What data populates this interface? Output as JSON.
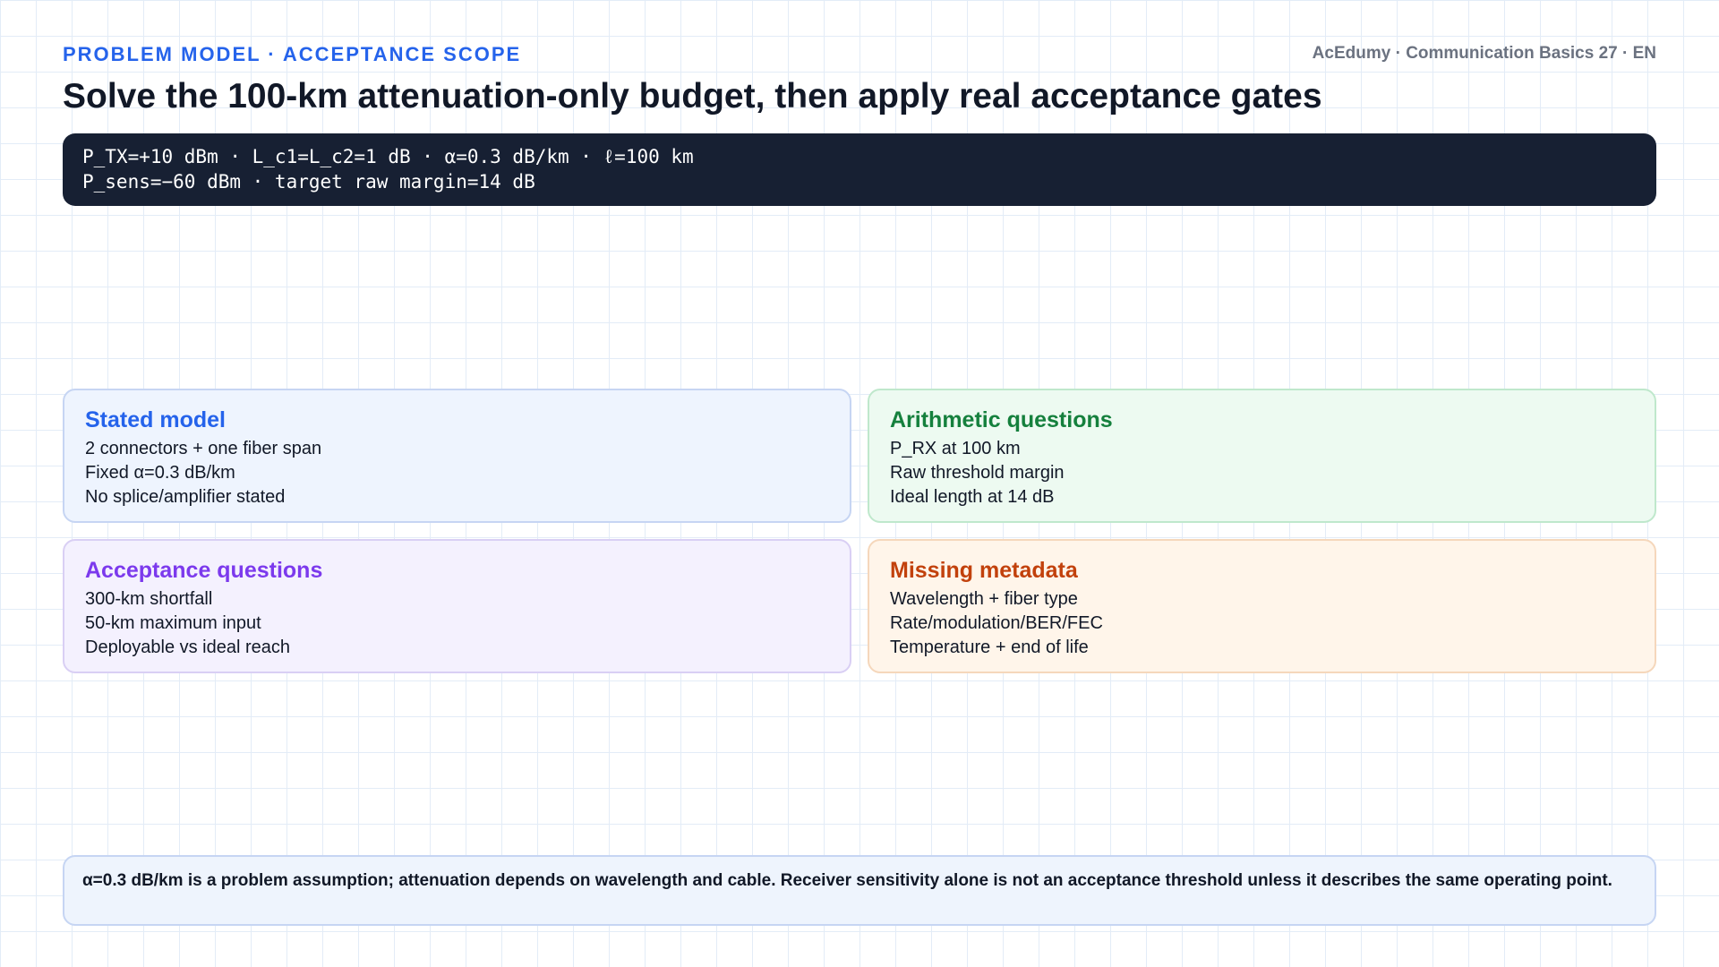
{
  "header": {
    "eyebrow": "PROBLEM MODEL · ACCEPTANCE SCOPE",
    "brand": "AcEdumy · Communication Basics 27 · EN",
    "title": "Solve the 100-km attenuation-only budget, then apply real acceptance gates"
  },
  "formula": {
    "lines": [
      "P_TX=+10 dBm · L_c1=L_c2=1 dB · α=0.3 dB/km · ℓ=100 km",
      "P_sens=−60 dBm · target raw margin=14 dB"
    ]
  },
  "cards": [
    {
      "title": "Stated model",
      "lines": [
        "2 connectors + one fiber span",
        "Fixed α=0.3 dB/km",
        "No splice/amplifier stated"
      ]
    },
    {
      "title": "Arithmetic questions",
      "lines": [
        "P_RX at 100 km",
        "Raw threshold margin",
        "Ideal length at 14 dB"
      ]
    },
    {
      "title": "Acceptance questions",
      "lines": [
        "300-km shortfall",
        "50-km maximum input",
        "Deployable vs ideal reach"
      ]
    },
    {
      "title": "Missing metadata",
      "lines": [
        "Wavelength + fiber type",
        "Rate/modulation/BER/FEC",
        "Temperature + end of life"
      ]
    }
  ],
  "note": {
    "text": "α=0.3 dB/km is a problem assumption; attenuation depends on wavelength and cable. Receiver sensitivity alone is not an acceptance threshold unless it describes the same operating point."
  },
  "colors": {
    "accent_blue": "#2563eb",
    "accent_green": "#15803d",
    "accent_purple": "#7c3aed",
    "accent_orange": "#c2410c",
    "formula_background": "#172033"
  }
}
